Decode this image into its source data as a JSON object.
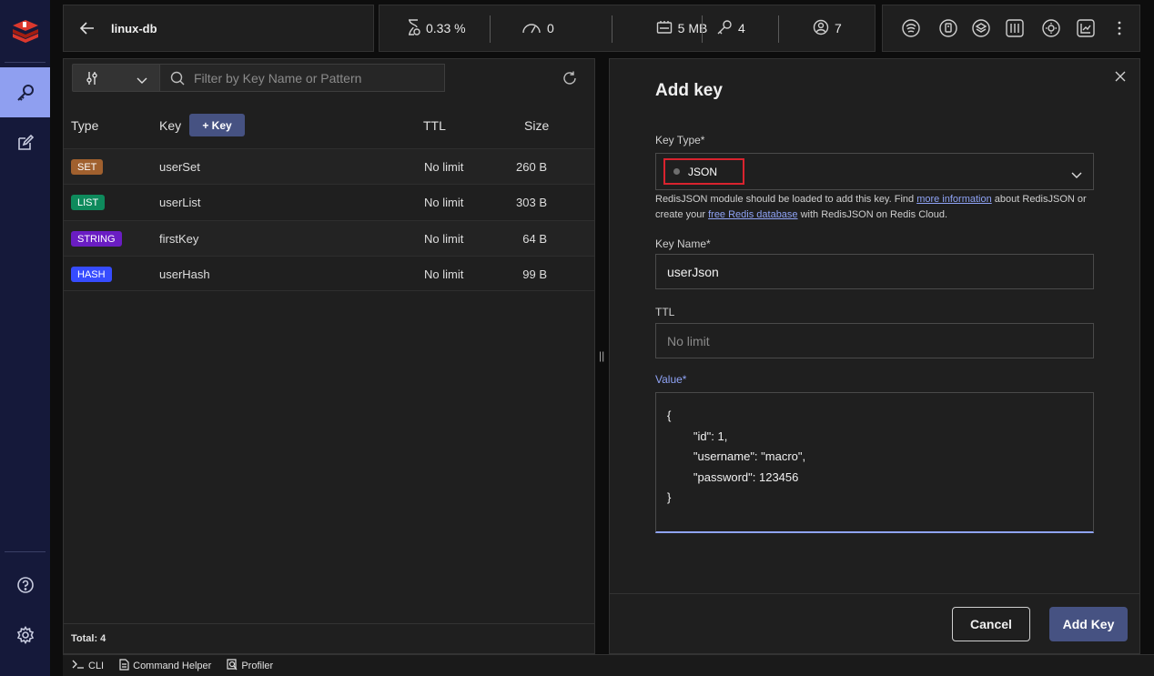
{
  "header": {
    "db_name": "linux-db",
    "stats": {
      "cpu": "0.33 %",
      "ops": "0",
      "memory": "5 MB",
      "keys": "4",
      "clients": "7"
    }
  },
  "browser": {
    "filter_placeholder": "Filter by Key Name or Pattern",
    "columns": {
      "type": "Type",
      "key": "Key",
      "ttl": "TTL",
      "size": "Size"
    },
    "add_key_label": "+ Key",
    "rows": [
      {
        "type": "SET",
        "type_color": "#a0602e",
        "key": "userSet",
        "ttl": "No limit",
        "size": "260 B"
      },
      {
        "type": "LIST",
        "type_color": "#0e8a5c",
        "key": "userList",
        "ttl": "No limit",
        "size": "303 B"
      },
      {
        "type": "STRING",
        "type_color": "#6a1dc3",
        "key": "firstKey",
        "ttl": "No limit",
        "size": "64 B"
      },
      {
        "type": "HASH",
        "type_color": "#364cff",
        "key": "userHash",
        "ttl": "No limit",
        "size": "99 B"
      }
    ],
    "total": "Total: 4"
  },
  "form": {
    "title": "Add key",
    "key_type_label": "Key Type*",
    "key_type_value": "JSON",
    "hint_text_1": "RedisJSON module should be loaded to add this key. Find ",
    "hint_link_1": "more information",
    "hint_text_2": " about RedisJSON or create your ",
    "hint_link_2": "free Redis database",
    "hint_text_3": " with RedisJSON on Redis Cloud.",
    "key_name_label": "Key Name*",
    "key_name_value": "userJson",
    "ttl_label": "TTL",
    "ttl_placeholder": "No limit",
    "value_label": "Value*",
    "value_text": "{\n        \"id\": 1,\n        \"username\": \"macro\",\n        \"password\": 123456\n}",
    "cancel_label": "Cancel",
    "submit_label": "Add Key"
  },
  "bottom_bar": {
    "cli": "CLI",
    "command_helper": "Command Helper",
    "profiler": "Profiler"
  },
  "colors": {
    "accent": "#465282",
    "rail": "#15193a",
    "rail_active": "#8f9ff0",
    "highlight_box": "#d9232e"
  }
}
